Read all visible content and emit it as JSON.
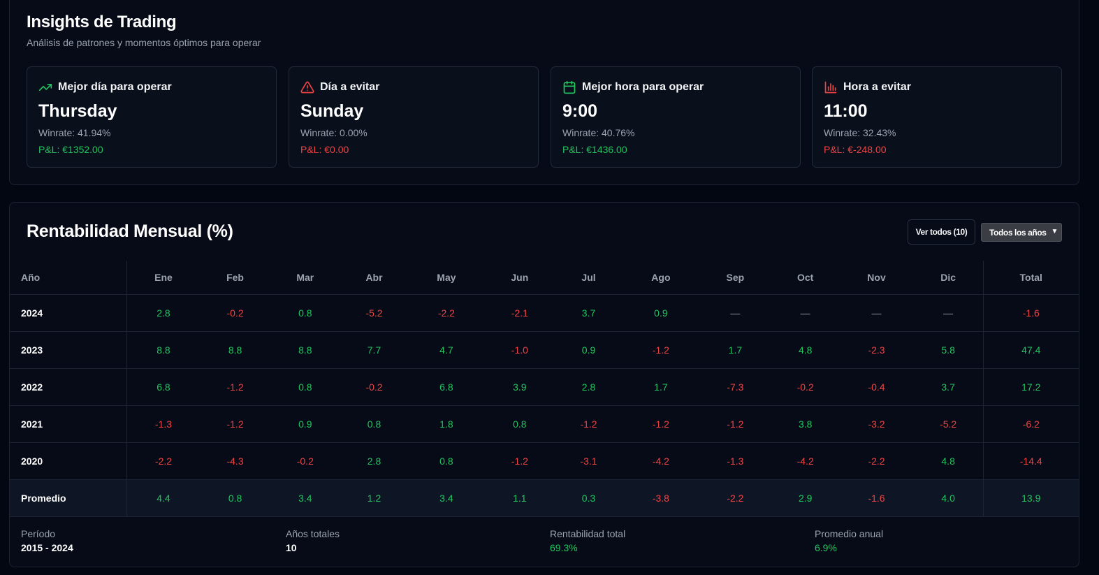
{
  "insights": {
    "title": "Insights de Trading",
    "subtitle": "Análisis de patrones y momentos óptimos para operar",
    "cards": [
      {
        "icon": "trending-up-icon",
        "label": "Mejor día para operar",
        "value": "Thursday",
        "winrate": "Winrate: 41.94%",
        "pl": "P&L: €1352.00",
        "pl_positive": true
      },
      {
        "icon": "alert-triangle-icon",
        "label": "Día a evitar",
        "value": "Sunday",
        "winrate": "Winrate: 0.00%",
        "pl": "P&L: €0.00",
        "pl_positive": false
      },
      {
        "icon": "calendar-icon",
        "label": "Mejor hora para operar",
        "value": "9:00",
        "winrate": "Winrate: 40.76%",
        "pl": "P&L: €1436.00",
        "pl_positive": true
      },
      {
        "icon": "bar-chart-icon",
        "label": "Hora a evitar",
        "value": "11:00",
        "winrate": "Winrate: 32.43%",
        "pl": "P&L: €-248.00",
        "pl_positive": false
      }
    ],
    "colors": {
      "positive": "#22c55e",
      "negative": "#ef4444"
    }
  },
  "monthly": {
    "title": "Rentabilidad Mensual (%)",
    "view_all_label": "Ver todos (10)",
    "year_filter": "Todos los años",
    "headers": [
      "Año",
      "Ene",
      "Feb",
      "Mar",
      "Abr",
      "May",
      "Jun",
      "Jul",
      "Ago",
      "Sep",
      "Oct",
      "Nov",
      "Dic",
      "Total"
    ],
    "rows": [
      {
        "year": "2024",
        "values": [
          "2.8",
          "-0.2",
          "0.8",
          "-5.2",
          "-2.2",
          "-2.1",
          "3.7",
          "0.9",
          "—",
          "—",
          "—",
          "—"
        ],
        "total": "-1.6"
      },
      {
        "year": "2023",
        "values": [
          "8.8",
          "8.8",
          "8.8",
          "7.7",
          "4.7",
          "-1.0",
          "0.9",
          "-1.2",
          "1.7",
          "4.8",
          "-2.3",
          "5.8"
        ],
        "total": "47.4"
      },
      {
        "year": "2022",
        "values": [
          "6.8",
          "-1.2",
          "0.8",
          "-0.2",
          "6.8",
          "3.9",
          "2.8",
          "1.7",
          "-7.3",
          "-0.2",
          "-0.4",
          "3.7"
        ],
        "total": "17.2"
      },
      {
        "year": "2021",
        "values": [
          "-1.3",
          "-1.2",
          "0.9",
          "0.8",
          "1.8",
          "0.8",
          "-1.2",
          "-1.2",
          "-1.2",
          "3.8",
          "-3.2",
          "-5.2"
        ],
        "total": "-6.2"
      },
      {
        "year": "2020",
        "values": [
          "-2.2",
          "-4.3",
          "-0.2",
          "2.8",
          "0.8",
          "-1.2",
          "-3.1",
          "-4.2",
          "-1.3",
          "-4.2",
          "-2.2",
          "4.8"
        ],
        "total": "-14.4"
      }
    ],
    "average": {
      "label": "Promedio",
      "values": [
        "4.4",
        "0.8",
        "3.4",
        "1.2",
        "3.4",
        "1.1",
        "0.3",
        "-3.8",
        "-2.2",
        "2.9",
        "-1.6",
        "4.0"
      ],
      "total": "13.9"
    },
    "footer": [
      {
        "label": "Período",
        "value": "2015 - 2024",
        "positive": false
      },
      {
        "label": "Años totales",
        "value": "10",
        "positive": false
      },
      {
        "label": "Rentabilidad total",
        "value": "69.3%",
        "positive": true
      },
      {
        "label": "Promedio anual",
        "value": "6.9%",
        "positive": true
      }
    ]
  }
}
